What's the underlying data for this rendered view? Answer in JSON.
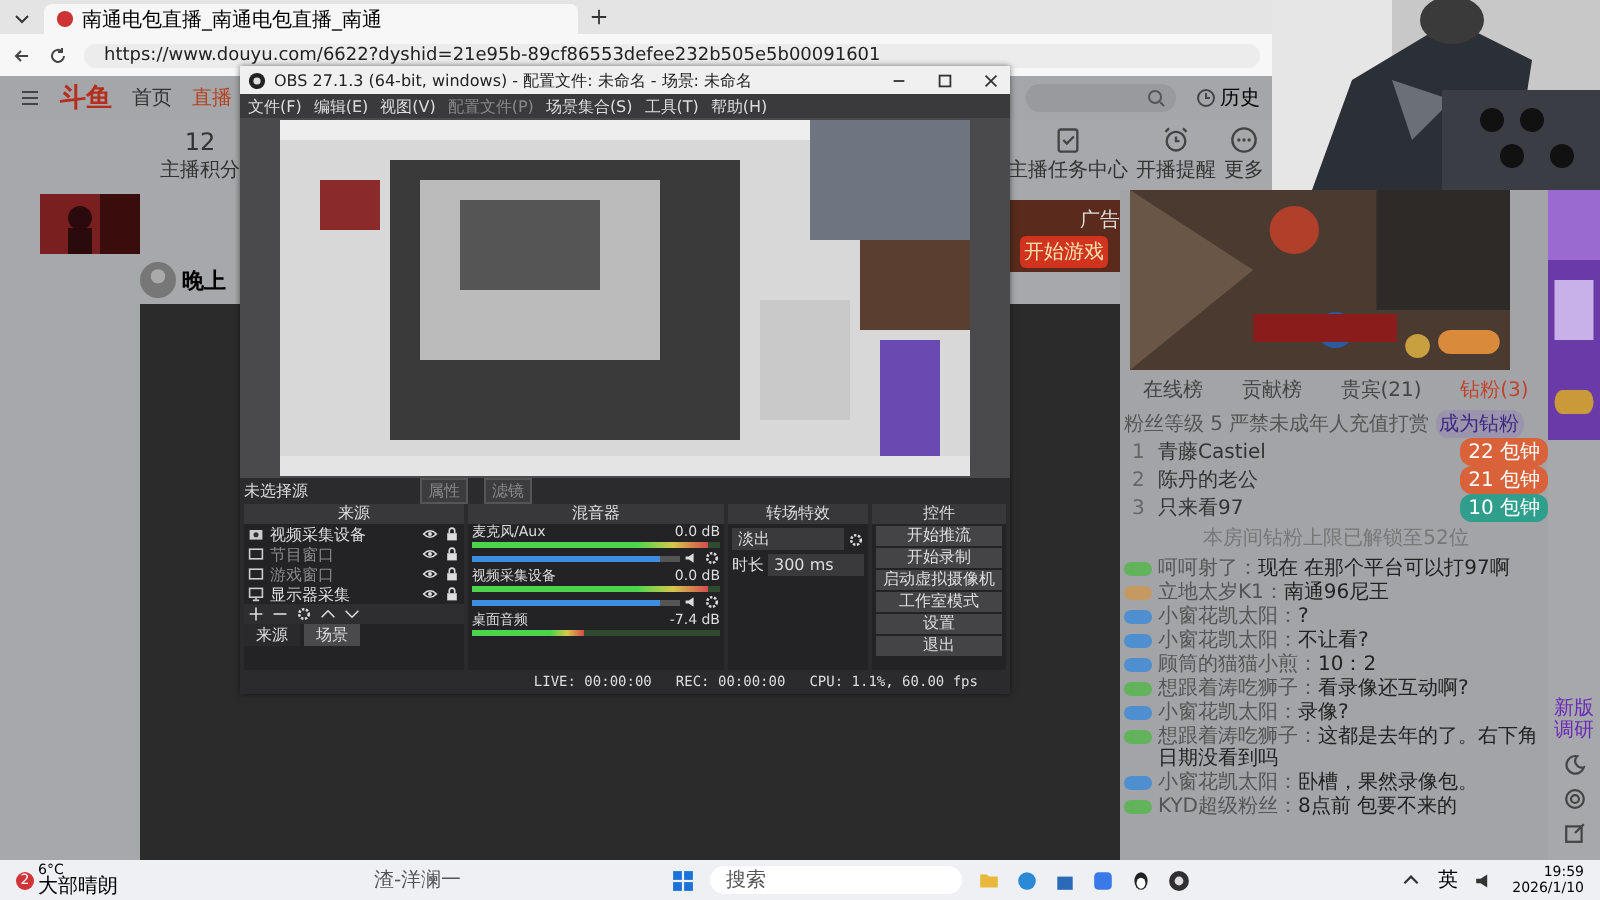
{
  "browser": {
    "tab_title": "南通电包直播_南通电包直播_南通",
    "url": "https://www.douyu.com/6622?dyshid=21e95b-89cf86553defee232b505e5b00091601"
  },
  "site": {
    "logo": "斗鱼",
    "nav": [
      {
        "label": "首页",
        "selected": false
      },
      {
        "label": "直播",
        "selected": true
      }
    ],
    "history": "历史",
    "points": {
      "value": "12",
      "label": "主播积分"
    },
    "shortcuts": [
      {
        "label": "主播任务中心",
        "kind": "task"
      },
      {
        "label": "开播提醒",
        "kind": "alarm"
      },
      {
        "label": "更多",
        "kind": "more"
      }
    ],
    "streamer": "晚上",
    "ad_button": "开始游戏",
    "ad_tag": "广告",
    "side_label": "新版调研"
  },
  "ranking": {
    "tabs": [
      {
        "label": "在线榜",
        "selected": false
      },
      {
        "label": "贡献榜",
        "selected": false
      },
      {
        "label": "贵宾(21)",
        "selected": false
      },
      {
        "label": "钻粉(3)",
        "selected": true
      }
    ],
    "fan_level": "粉丝等级 5",
    "notice": "严禁未成年人充值打赏",
    "join_button": "成为钻粉",
    "rows": [
      {
        "rank": "1",
        "name": "青藤Castiel",
        "level": "22",
        "badge": "包钟",
        "color": "#d9623a"
      },
      {
        "rank": "2",
        "name": "陈丹的老公",
        "level": "21",
        "badge": "包钟",
        "color": "#d9623a"
      },
      {
        "rank": "3",
        "name": "只来看97",
        "level": "10",
        "badge": "包钟",
        "color": "#2f9e8c"
      }
    ],
    "footer": "本房间钻粉上限已解锁至52位"
  },
  "chat": [
    {
      "color": "#63b35c",
      "name": "呵呵射了：",
      "text": "现在 在那个平台可以打97啊"
    },
    {
      "color": "#c49a62",
      "name": "立地太岁K1：",
      "text": "南通96尼王"
    },
    {
      "color": "#4f8fd0",
      "name": "小窗花凯太阳：",
      "text": "?"
    },
    {
      "color": "#4f8fd0",
      "name": "小窗花凯太阳：",
      "text": "不让看?"
    },
    {
      "color": "#4f8fd0",
      "name": "顾筒的猫猫小煎：",
      "text": "10：2"
    },
    {
      "color": "#63b35c",
      "name": "想跟着涛吃狮子：",
      "text": "看录像还互动啊?"
    },
    {
      "color": "#4f8fd0",
      "name": "小窗花凯太阳：",
      "text": "录像?"
    },
    {
      "color": "#63b35c",
      "name": "想跟着涛吃狮子：",
      "text": "这都是去年的了。右下角日期没看到吗"
    },
    {
      "color": "#4f8fd0",
      "name": "小窗花凯太阳：",
      "text": "卧槽，果然录像包。"
    },
    {
      "color": "#63b35c",
      "name": "KYD超级粉丝：",
      "text": "8点前 包要不来的"
    }
  ],
  "obs": {
    "title": "OBS 27.1.3 (64-bit, windows) - 配置文件: 未命名 - 场景: 未命名",
    "menu": [
      {
        "label": "文件(F)",
        "disabled": false
      },
      {
        "label": "编辑(E)",
        "disabled": false
      },
      {
        "label": "视图(V)",
        "disabled": false
      },
      {
        "label": "配置文件(P)",
        "disabled": true
      },
      {
        "label": "场景集合(S)",
        "disabled": false
      },
      {
        "label": "工具(T)",
        "disabled": false
      },
      {
        "label": "帮助(H)",
        "disabled": false
      }
    ],
    "source_bar": {
      "label": "未选择源",
      "buttons": [
        "属性",
        "滤镜"
      ]
    },
    "docks": [
      "来源",
      "混音器",
      "转场特效",
      "控件"
    ],
    "sources": [
      {
        "kind": "camera",
        "name": "视频采集设备",
        "disabled": false
      },
      {
        "kind": "window",
        "name": "节目窗口",
        "disabled": true
      },
      {
        "kind": "window",
        "name": "游戏窗口",
        "disabled": true
      },
      {
        "kind": "monitor",
        "name": "显示器采集",
        "disabled": false
      }
    ],
    "bottom_tabs": [
      {
        "label": "来源",
        "selected": false
      },
      {
        "label": "场景",
        "selected": true
      }
    ],
    "mixer": [
      {
        "name": "麦克风/Aux",
        "reading": "0.0 dB",
        "meter": {
          "level": 0.95
        },
        "volume": {
          "level": 0.9
        }
      },
      {
        "name": "视频采集设备",
        "reading": "0.0 dB",
        "meter": {
          "level": 0.95
        },
        "volume": {
          "level": 0.9
        }
      },
      {
        "name": "桌面音频",
        "reading": "-7.4 dB",
        "meter": {
          "level": 0.45
        }
      }
    ],
    "transition": {
      "value": "淡出",
      "duration_label": "时长",
      "duration": "300 ms"
    },
    "controls": [
      "开始推流",
      "开始录制",
      "启动虚拟摄像机",
      "工作室模式",
      "设置",
      "退出"
    ],
    "status": [
      "LIVE: 00:00:00",
      "REC: 00:00:00",
      "CPU: 1.1%, 60.00 fps"
    ]
  },
  "taskbar": {
    "weather_badge": "2",
    "temperature": "6°C",
    "weather": "大部晴朗",
    "media": "渣-洋澜一",
    "search_placeholder": "搜索",
    "language": "英",
    "time": "19:59",
    "date": "2026/1/10"
  }
}
